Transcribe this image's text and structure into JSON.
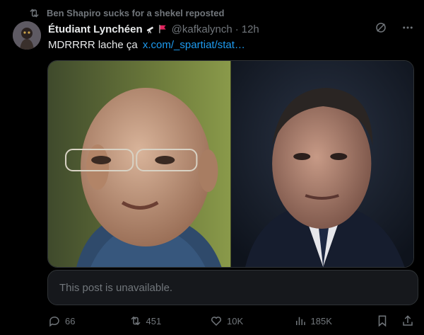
{
  "repost": {
    "text": "Ben Shapiro sucks for a shekel reposted",
    "icon": "repost-icon"
  },
  "author": {
    "name": "Étudiant Lynchéen",
    "emoji": [
      "🔭",
      "🚩"
    ],
    "handle": "@kafkalynch",
    "separator": "·",
    "time": "12h"
  },
  "header_actions": [
    "grok-icon",
    "more-icon"
  ],
  "post": {
    "text": "MDRRRR lache ça",
    "link": "x.com/_spartiat/stat…"
  },
  "quote": {
    "text": "This post is unavailable."
  },
  "actions": {
    "replies": "66",
    "reposts": "451",
    "likes": "10K",
    "views": "185K"
  },
  "colors": {
    "background": "#000000",
    "text": "#e7e9ea",
    "muted": "#71767b",
    "link": "#1d9bf0",
    "border": "#2f3336",
    "quote_bg": "#16181c",
    "flag": "#e0245e"
  }
}
